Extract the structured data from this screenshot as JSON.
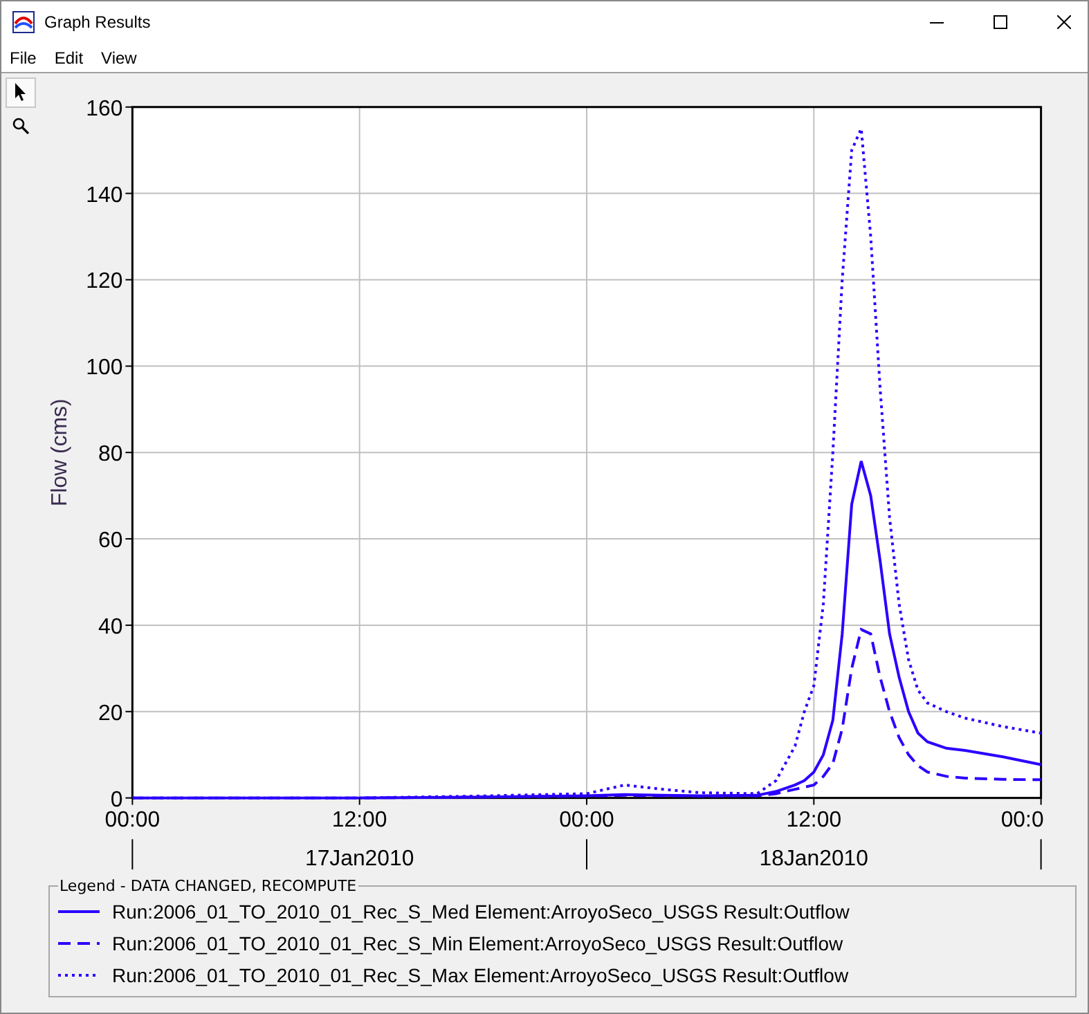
{
  "window": {
    "title": "Graph Results"
  },
  "menu": [
    "File",
    "Edit",
    "View"
  ],
  "tools": [
    {
      "kind": "pointer",
      "selected": true
    },
    {
      "kind": "zoom",
      "selected": false
    }
  ],
  "graph": {
    "chart_data": {
      "type": "line",
      "ylabel": "Flow (cms)",
      "grid": true,
      "x": [
        "2010-01-17T00:00",
        "2010-01-17T12:00",
        "2010-01-17T18:00",
        "2010-01-18T00:00",
        "2010-01-18T02:00",
        "2010-01-18T04:00",
        "2010-01-18T06:00",
        "2010-01-18T09:00",
        "2010-01-18T10:00",
        "2010-01-18T11:00",
        "2010-01-18T11:30",
        "2010-01-18T12:00",
        "2010-01-18T12:30",
        "2010-01-18T13:00",
        "2010-01-18T13:30",
        "2010-01-18T14:00",
        "2010-01-18T14:30",
        "2010-01-18T15:00",
        "2010-01-18T15:30",
        "2010-01-18T16:00",
        "2010-01-18T16:30",
        "2010-01-18T17:00",
        "2010-01-18T17:30",
        "2010-01-18T18:00",
        "2010-01-18T19:00",
        "2010-01-18T20:00",
        "2010-01-18T22:00",
        "2010-01-19T00:00"
      ],
      "series": [
        {
          "name": "Run:2006_01_TO_2010_01_Rec_S_Med Element:ArroyoSeco_USGS Result:Outflow",
          "color": "#2a00ff",
          "line_style": "solid",
          "values": [
            0,
            0,
            0.2,
            0.5,
            0.8,
            0.6,
            0.5,
            0.6,
            1.5,
            3,
            4,
            6,
            10,
            18,
            38,
            68,
            78,
            70,
            55,
            38,
            28,
            20,
            15,
            13,
            11.5,
            11,
            9.5,
            7.7
          ]
        },
        {
          "name": "Run:2006_01_TO_2010_01_Rec_S_Min Element:ArroyoSeco_USGS Result:Outflow",
          "color": "#2a00ff",
          "line_style": "dashed",
          "values": [
            0,
            0,
            0.2,
            0.4,
            0.6,
            0.5,
            0.4,
            0.5,
            1,
            2,
            2.5,
            3,
            5,
            8,
            16,
            30,
            39,
            38,
            28,
            20,
            14,
            10,
            7.5,
            6,
            5,
            4.6,
            4.3,
            4.2
          ]
        },
        {
          "name": "Run:2006_01_TO_2010_01_Rec_S_Max Element:ArroyoSeco_USGS Result:Outflow",
          "color": "#2a00ff",
          "line_style": "dotted",
          "values": [
            0,
            0,
            0.4,
            1,
            3,
            2,
            1.2,
            1,
            4,
            12,
            20,
            26,
            45,
            80,
            120,
            150,
            155,
            130,
            95,
            65,
            45,
            32,
            25,
            22,
            20,
            18.5,
            16.5,
            15
          ]
        }
      ],
      "xlim": [
        "2010-01-17T00:00",
        "2010-01-19T00:00"
      ],
      "ylim": [
        0,
        160
      ],
      "xticks": [
        {
          "value": "2010-01-17T00:00",
          "label": "00:00"
        },
        {
          "value": "2010-01-17T12:00",
          "label": "12:00"
        },
        {
          "value": "2010-01-18T00:00",
          "label": "00:00"
        },
        {
          "value": "2010-01-18T12:00",
          "label": "12:00"
        },
        {
          "value": "2010-01-19T00:00",
          "label": "00:0"
        }
      ],
      "yticks": [
        0,
        20,
        40,
        60,
        80,
        100,
        120,
        140,
        160
      ]
    },
    "date_labels": [
      "17Jan2010",
      "18Jan2010"
    ]
  },
  "legend": {
    "title": "Legend - DATA CHANGED, RECOMPUTE"
  }
}
